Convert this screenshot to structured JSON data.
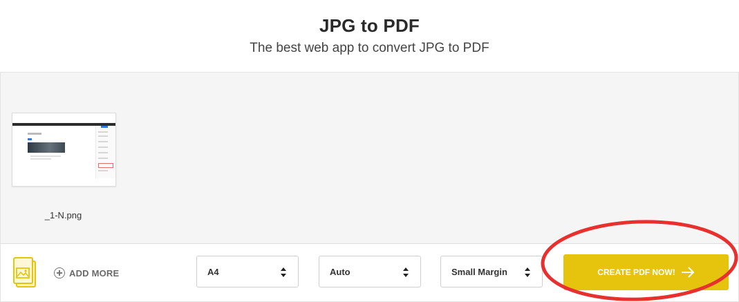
{
  "header": {
    "title": "JPG to PDF",
    "subtitle": "The best web app to convert JPG to PDF"
  },
  "workspace": {
    "files": [
      {
        "name": "_1-N.png"
      }
    ]
  },
  "toolbar": {
    "file_icon": "image-file-stack-icon",
    "add_more_icon": "plus-circle-icon",
    "add_more_label": "ADD MORE",
    "page_size": "A4",
    "orientation": "Auto",
    "margin": "Small Margin",
    "cta_label": "CREATE PDF NOW!",
    "cta_icon": "arrow-right-icon"
  },
  "colors": {
    "accent": "#e6c40e",
    "highlight": "#e8302f",
    "background": "#f5f5f5"
  }
}
